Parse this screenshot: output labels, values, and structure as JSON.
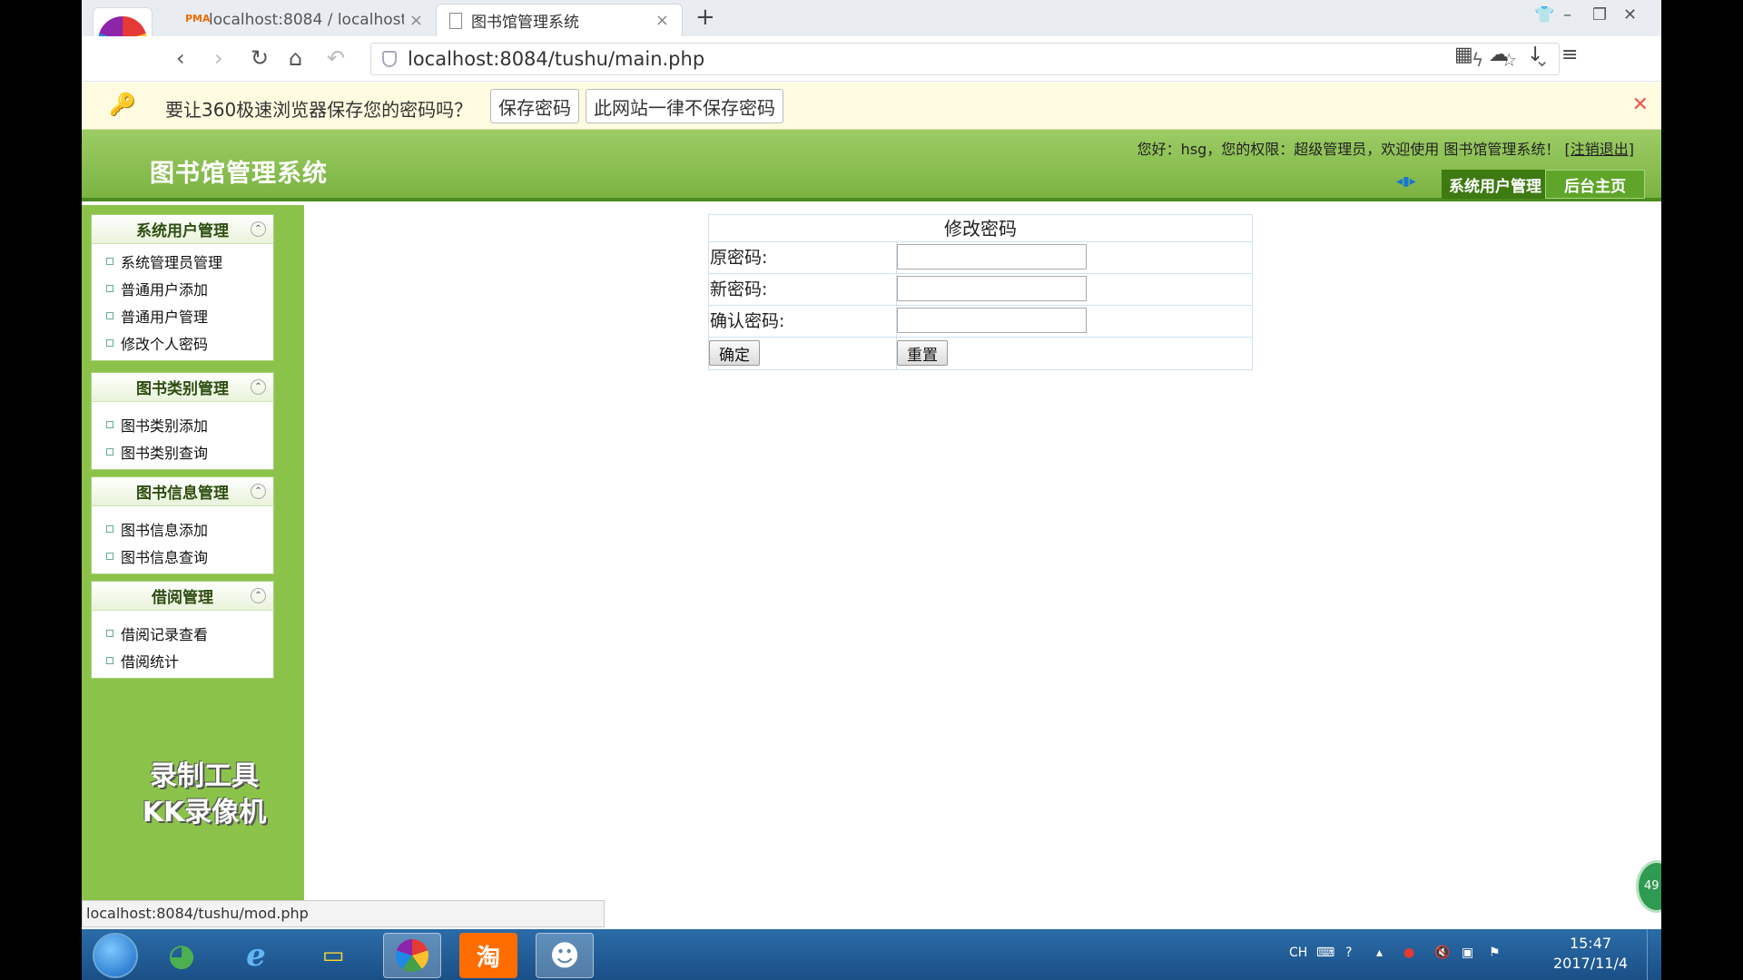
{
  "browser": {
    "tabs": [
      {
        "title": "localhost:8084 / localhost",
        "active": false
      },
      {
        "title": "图书馆管理系统",
        "active": true
      }
    ],
    "new_tab_label": "+",
    "url": "localhost:8084/tushu/main.php",
    "status_url": "localhost:8084/tushu/mod.php"
  },
  "password_bar": {
    "message": "要让360极速浏览器保存您的密码吗？",
    "save_label": "保存密码",
    "never_label": "此网站一律不保存密码"
  },
  "header": {
    "site_title": "图书馆管理系统",
    "welcome_prefix": "您好：hsg，您的权限：超级管理员，欢迎使用 图书馆管理系统！",
    "logout_label": "[注销退出]",
    "nav_current": "系统用户管理",
    "nav_home": "后台主页"
  },
  "sidebar": {
    "groups": [
      {
        "title": "系统用户管理",
        "items": [
          "系统管理员管理",
          "普通用户添加",
          "普通用户管理",
          "修改个人密码"
        ]
      },
      {
        "title": "图书类别管理",
        "items": [
          "图书类别添加",
          "图书类别查询"
        ]
      },
      {
        "title": "图书信息管理",
        "items": [
          "图书信息添加",
          "图书信息查询"
        ]
      },
      {
        "title": "借阅管理",
        "items": [
          "借阅记录查看",
          "借阅统计"
        ]
      }
    ],
    "watermark_line1": "录制工具",
    "watermark_line2": "KK录像机"
  },
  "form": {
    "title": "修改密码",
    "old_label": "原密码:",
    "new_label": "新密码:",
    "confirm_label": "确认密码:",
    "old_value": "",
    "new_value": "",
    "confirm_value": "",
    "submit_label": "确定",
    "reset_label": "重置"
  },
  "float_badge": "49",
  "taskbar": {
    "apps": [
      "app-360safe",
      "internet-explorer",
      "file-explorer",
      "browser-360",
      "taobao",
      "kk-recorder"
    ],
    "taobao_label": "淘",
    "lang": "CH",
    "time": "15:47",
    "date": "2017/11/4"
  },
  "colors": {
    "header_green": "#7cb342",
    "sidebar_green": "#8bc34a",
    "taskbar_blue": "#1a4f86"
  }
}
